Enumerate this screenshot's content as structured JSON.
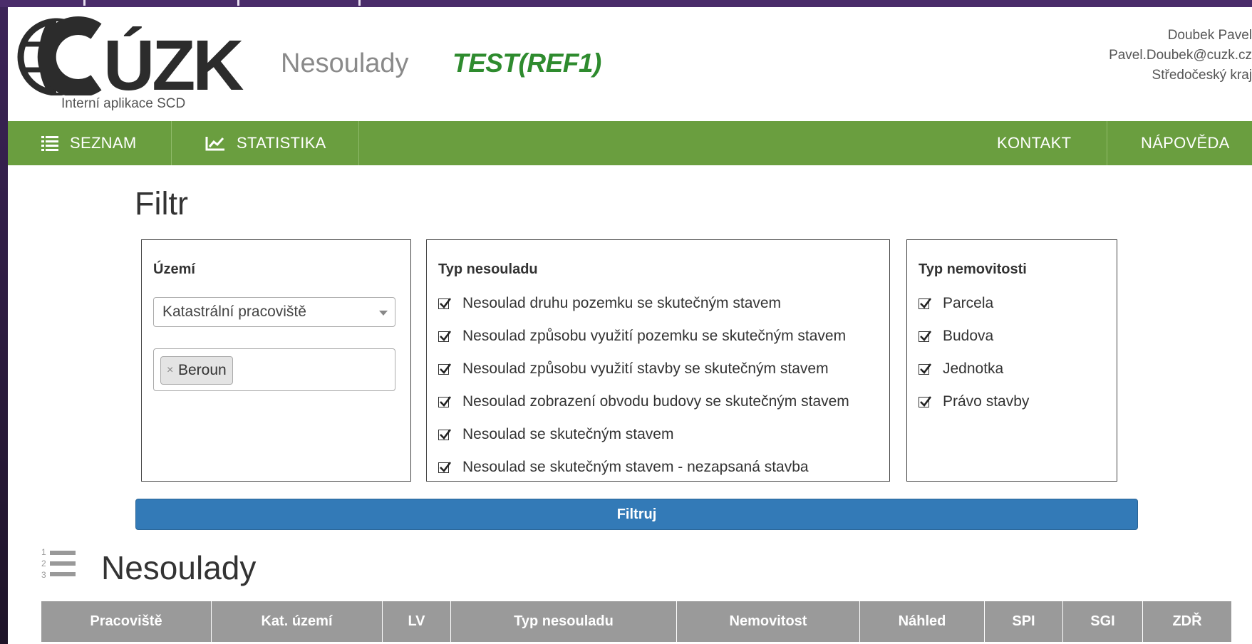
{
  "header": {
    "logo_text": "ČÚZK",
    "logo_subtitle": "Interní aplikace SCD",
    "app_title": "Nesoulady",
    "environment": "TEST(REF1)",
    "user": {
      "name": "Doubek Pavel",
      "email": "Pavel.Doubek@cuzk.cz",
      "region": "Středočeský kraj"
    }
  },
  "nav": {
    "items": [
      {
        "label": "SEZNAM",
        "icon": "list-icon"
      },
      {
        "label": "STATISTIKA",
        "icon": "line-chart-icon"
      },
      {
        "label": "KONTAKT"
      },
      {
        "label": "NÁPOVĚDA"
      }
    ]
  },
  "filter": {
    "title": "Filtr",
    "uzemi": {
      "title": "Území",
      "select_value": "Katastrální pracoviště",
      "selected_tags": [
        {
          "remove": "×",
          "label": "Beroun"
        }
      ]
    },
    "typ_nesouladu": {
      "title": "Typ nesouladu",
      "options": [
        {
          "label": "Nesoulad druhu pozemku se skutečným stavem",
          "checked": true
        },
        {
          "label": "Nesoulad způsobu využití pozemku se skutečným stavem",
          "checked": true
        },
        {
          "label": "Nesoulad způsobu využití stavby se skutečným stavem",
          "checked": true
        },
        {
          "label": "Nesoulad zobrazení obvodu budovy se skutečným stavem",
          "checked": true
        },
        {
          "label": "Nesoulad se skutečným stavem",
          "checked": true
        },
        {
          "label": "Nesoulad se skutečným stavem - nezapsaná stavba",
          "checked": true
        }
      ]
    },
    "typ_nemovitosti": {
      "title": "Typ nemovitosti",
      "options": [
        {
          "label": "Parcela",
          "checked": true
        },
        {
          "label": "Budova",
          "checked": true
        },
        {
          "label": "Jednotka",
          "checked": true
        },
        {
          "label": "Právo stavby",
          "checked": true
        }
      ]
    },
    "submit_label": "Filtruj"
  },
  "results": {
    "title": "Nesoulady",
    "columns": [
      "Pracoviště",
      "Kat. území",
      "LV",
      "Typ nesouladu",
      "Nemovitost",
      "Náhled",
      "SPI",
      "SGI",
      "ZDŘ"
    ]
  },
  "colors": {
    "nav_green": "#6a9e3f",
    "env_green": "#2e8b2e",
    "button_blue": "#337ab7",
    "table_header_gray": "#9a9a9a"
  }
}
